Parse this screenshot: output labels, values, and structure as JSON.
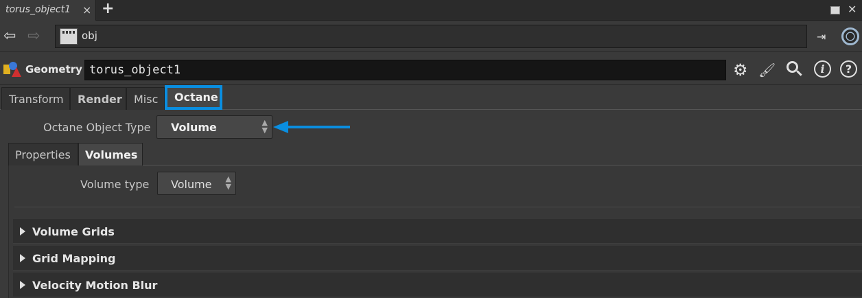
{
  "tabbar": {
    "tab_title": "torus_object1",
    "close_glyph": "×",
    "add_glyph": "+",
    "window_close_glyph": "✕"
  },
  "pathbar": {
    "path": "obj",
    "dropdown_glyph": "▼",
    "back_glyph": "⇦",
    "forward_glyph": "⇨",
    "pin_glyph": "⇥"
  },
  "node": {
    "type_label": "Geometry",
    "name": "torus_object1",
    "icons": [
      "gear-icon",
      "brush-icon",
      "search-icon",
      "info-icon",
      "help-icon"
    ],
    "info_glyph": "i",
    "help_glyph": "?"
  },
  "tabs": [
    {
      "label": "Transform"
    },
    {
      "label": "Render"
    },
    {
      "label": "Misc"
    },
    {
      "label": "Octane"
    }
  ],
  "octane": {
    "object_type_label": "Octane Object Type",
    "object_type_value": "Volume",
    "annotation_color": "#0a8ee0"
  },
  "subtabs": [
    {
      "label": "Properties"
    },
    {
      "label": "Volumes"
    }
  ],
  "volumes": {
    "volume_type_label": "Volume type",
    "volume_type_value": "Volume",
    "folders": [
      {
        "label": "Volume Grids"
      },
      {
        "label": "Grid Mapping"
      },
      {
        "label": "Velocity Motion Blur"
      }
    ]
  },
  "colors": {
    "background": "#3a3a3a",
    "accent": "#0a8ee0"
  }
}
